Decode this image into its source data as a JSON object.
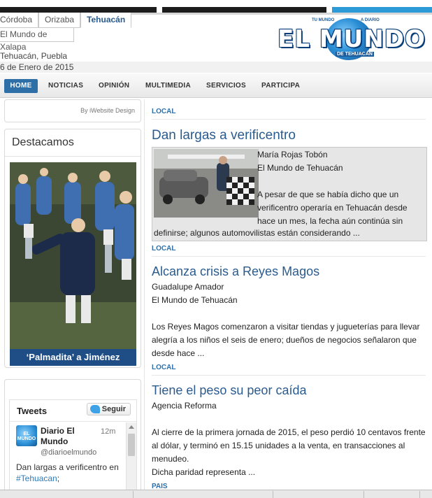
{
  "cities": {
    "tabs": [
      "Córdoba",
      "Orizaba",
      "Tehuacán"
    ],
    "active": "Tehuacán",
    "second_row": "El Mundo de Xalapa"
  },
  "logo": {
    "wordmark": "EL MUNDO",
    "tag_left": "TU MUNDO",
    "tag_right": "A DIARIO",
    "subtitle": "DE TEHUACÁN"
  },
  "location": "Tehuacán, Puebla",
  "date": "6 de Enero de 2015",
  "nav": {
    "items": [
      "HOME",
      "NOTICIAS",
      "OPINIÓN",
      "MULTIMEDIA",
      "SERVICIOS",
      "PARTICIPA"
    ]
  },
  "sidebar": {
    "credit": "By iWebsite Design",
    "destacamos": {
      "title": "Destacamos",
      "caption": "‘Palmadita’ a Jiménez"
    },
    "tweets": {
      "title": "Tweets",
      "follow_label": "Seguir",
      "tweet": {
        "name": "Diario El Mundo",
        "handle": "@diarioelmundo",
        "time": "12m",
        "avatar_text": "EL MUNDO",
        "text": "Dan largas a verificentro en ",
        "hashtag": "#Tehuacan",
        "text_end": ";"
      }
    }
  },
  "articles": [
    {
      "section": "LOCAL",
      "title": "Dan largas a verificentro",
      "author": "María Rojas Tobón",
      "outlet": "El Mundo de Tehuacán",
      "excerpt_part1": "A pesar de que se había dicho que un verificentro operaría en Tehuacán desde hace un mes, la fecha aún continúa sin",
      "excerpt_part2": "definirse; algunos automovilistas están considerando ..."
    },
    {
      "section": "LOCAL",
      "title": "Alcanza crisis a Reyes Magos",
      "author": "Guadalupe Amador",
      "outlet": "El Mundo de Tehuacán",
      "excerpt": "Los Reyes Magos comenzaron a visitar tiendas y jugueterías para llevar alegría a los niños el seis de enero; dueños de negocios señalaron que desde hace ..."
    },
    {
      "section": "LOCAL",
      "title": "Tiene el peso su peor caída",
      "author": "Agencia Reforma",
      "excerpt": "Al cierre de la primera jornada de 2015, el peso perdió 10 centavos frente al dólar, y terminó en 15.15 unidades a la venta, en transacciones al menudeo.",
      "excerpt2": "Dicha paridad representa ..."
    }
  ],
  "next_section": "PAIS"
}
